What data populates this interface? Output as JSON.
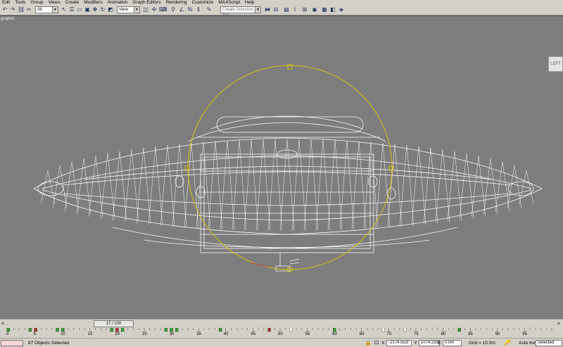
{
  "menu": [
    "Edit",
    "Tools",
    "Group",
    "Views",
    "Create",
    "Modifiers",
    "Animation",
    "Graph Editors",
    "Rendering",
    "Customize",
    "MAXScript",
    "Help"
  ],
  "toolbar": {
    "filter_value": "All",
    "view_value": "View",
    "selection_set_placeholder": "Create Selection Set"
  },
  "viewport": {
    "label": "graphic",
    "viewcube_label": "LEFT"
  },
  "timeline": {
    "frame_display": "17 / 100",
    "current_frame": 17,
    "total_frames": 100,
    "ticks": [
      "0",
      "5",
      "10",
      "15",
      "20",
      "25",
      "30",
      "35",
      "40",
      "45",
      "50",
      "55",
      "60",
      "65",
      "70",
      "75",
      "80",
      "85",
      "90",
      "95"
    ]
  },
  "status": {
    "objects_selected": "87 Objects Selected",
    "x_label": "X:",
    "x_value": "-2174.552r",
    "y_label": "Y:",
    "y_value": "1074.259r",
    "z_label": "Z:",
    "z_value": "0.0m",
    "grid_label": "Grid = 10.0m",
    "auto_key_label": "Auto Key",
    "key_mode_value": "Selected"
  },
  "colors": {
    "viewport_bg": "#7d7d7d",
    "wire": "#ffffff",
    "gizmo": "#d8c414",
    "ui_bg": "#d4d0c8"
  }
}
